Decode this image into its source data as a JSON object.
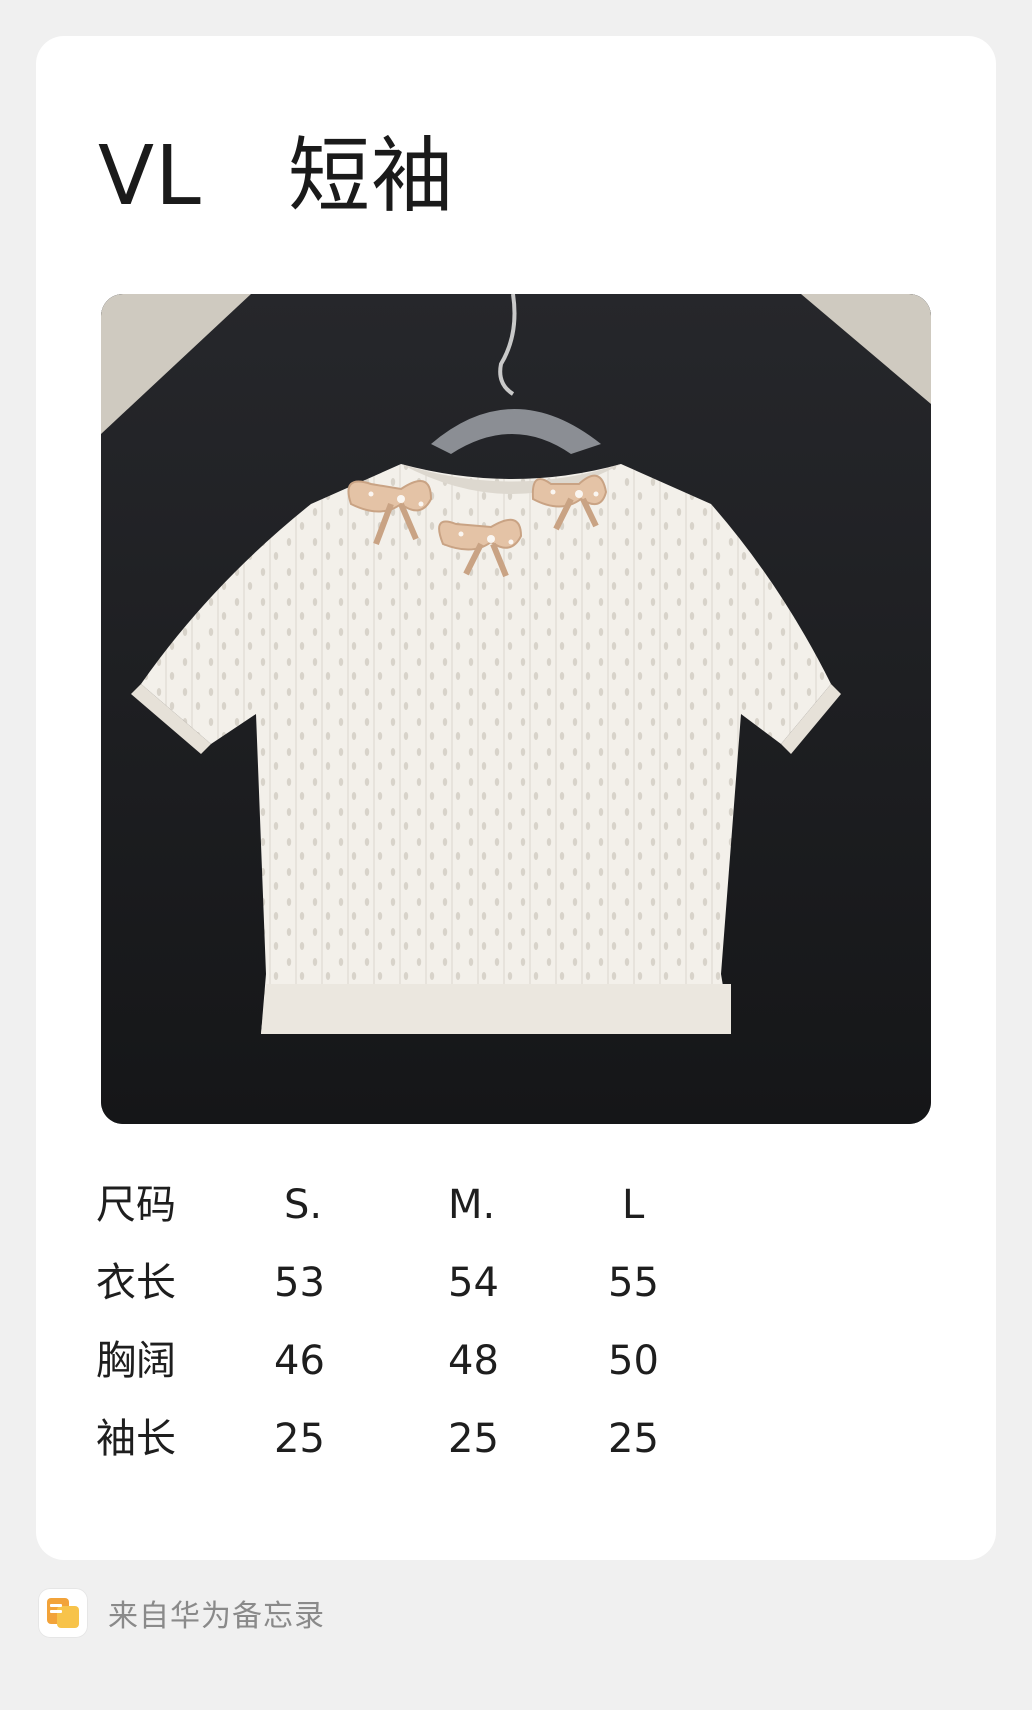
{
  "note": {
    "brand": "VL",
    "item": "短袖",
    "photo": {
      "subject": "white pointelle knit short-sleeve top with bow embellishments on hanger",
      "background_color": "#1b1c1f",
      "garment_color": "#f3f0ea",
      "bow_color": "#e4c3a6"
    },
    "size_table": {
      "header_label": "尺码",
      "sizes": [
        "S.",
        "M.",
        "L"
      ],
      "rows": [
        {
          "label": "衣长",
          "values": [
            "53",
            "54",
            "55"
          ]
        },
        {
          "label": "胸阔",
          "values": [
            "46",
            "48",
            "50"
          ]
        },
        {
          "label": "袖长",
          "values": [
            "25",
            "25",
            "25"
          ]
        }
      ]
    }
  },
  "footer": {
    "source_text": "来自华为备忘录",
    "icon": "notepad-icon"
  }
}
